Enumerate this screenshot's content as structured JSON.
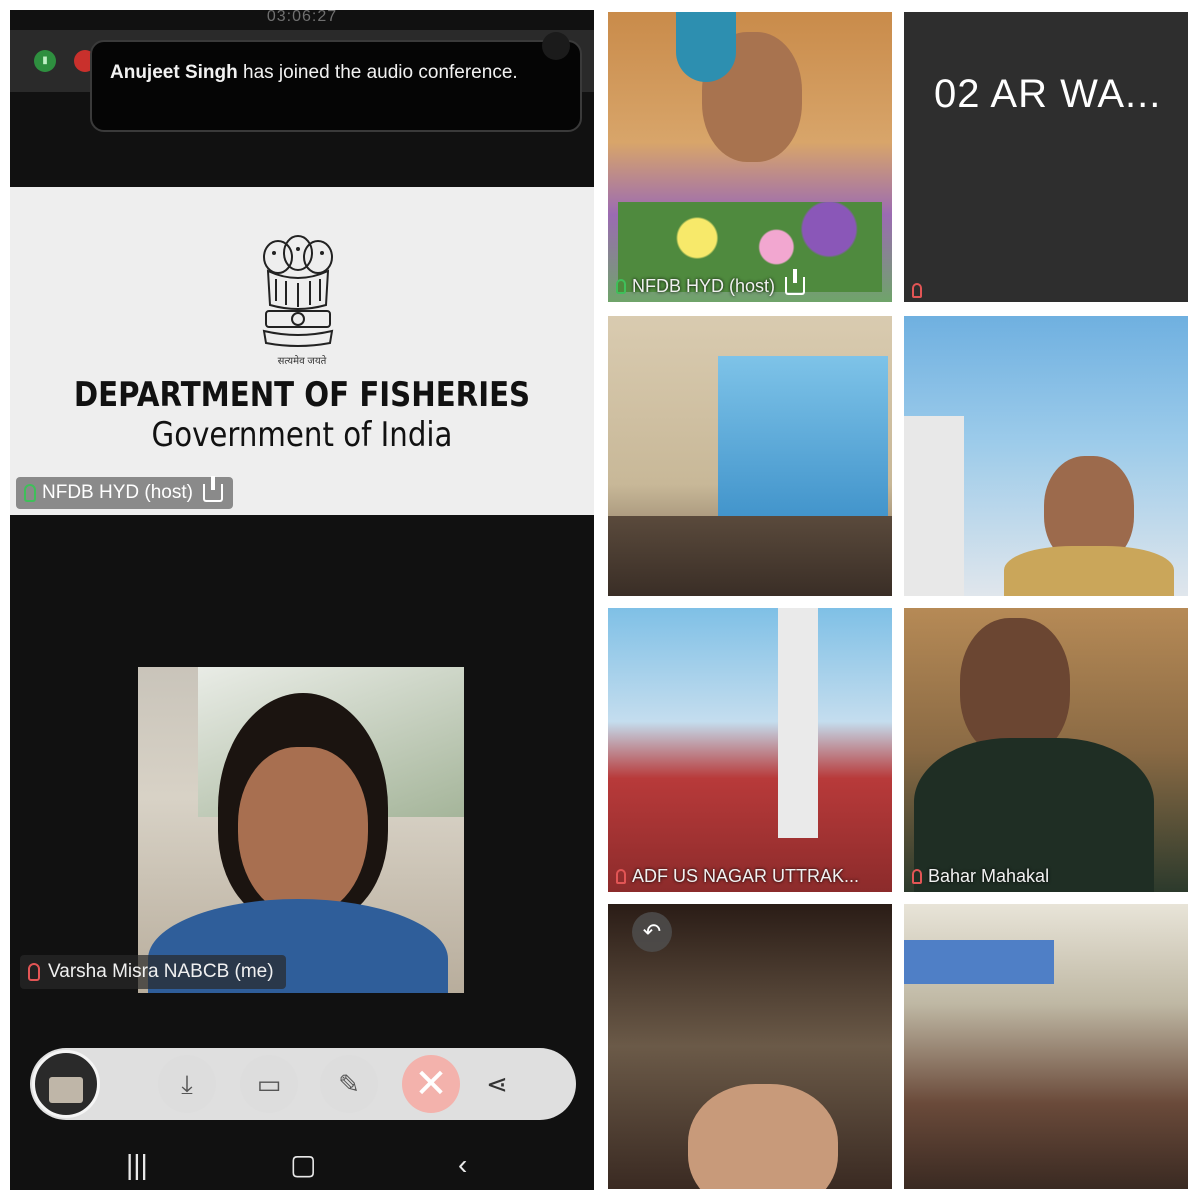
{
  "status": {
    "time": "03:06:27"
  },
  "toast": {
    "name": "Anujeet Singh",
    "message": " has joined the audio conference."
  },
  "share": {
    "title": "DEPARTMENT OF FISHERIES",
    "subtitle": "Government of India",
    "host_label": "NFDB HYD (host)"
  },
  "self": {
    "label": "Varsha Misra NABCB (me)"
  },
  "tiles": [
    {
      "label": "NFDB HYD (host)"
    },
    {
      "label": "",
      "name_big": "02 AR WA..."
    },
    {
      "label": ""
    },
    {
      "label": ""
    },
    {
      "label": "ADF US NAGAR UTTRAK..."
    },
    {
      "label": "Bahar Mahakal"
    },
    {
      "label": ""
    },
    {
      "label": ""
    }
  ],
  "colors": {
    "host_mic": "#3fbf5a",
    "muted_mic": "#e25555",
    "stop_share": "#f3b2ac"
  },
  "icons": {
    "controls": [
      "participants-thumbnail",
      "screenshot-icon",
      "video-icon",
      "annotate-icon",
      "stop-share-icon",
      "share-icon"
    ],
    "nav": [
      "recent-apps-icon",
      "home-icon",
      "back-icon"
    ]
  }
}
